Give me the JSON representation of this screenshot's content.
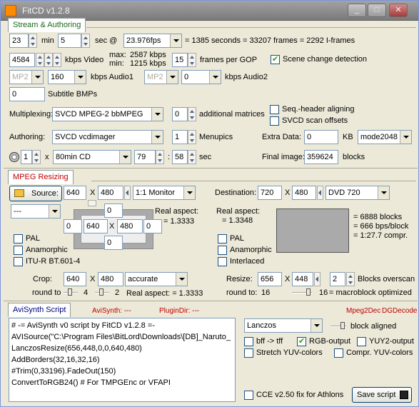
{
  "window": {
    "title": "FitCD v1.2.8",
    "buttons": [
      "_",
      "□",
      "✕"
    ]
  },
  "stream": {
    "tab": "Stream & Authoring",
    "minutes": "23",
    "min_label": "min",
    "seconds": "5",
    "sec_label": "sec @",
    "fps": "23.976fps",
    "summary": "= 1385 seconds = 33207 frames = 2292 I-frames",
    "video_kbps": "4584",
    "kbps_video_label": "kbps Video",
    "max_label": "max:",
    "max_kbps": "2587 kbps",
    "min_label2": "min:",
    "min_kbps": "1215 kbps",
    "gop": "15",
    "gop_label": "frames per GOP",
    "scene_change": "Scene change detection",
    "audio1_codec": "MP2",
    "audio1_kbps": "160",
    "audio1_label": "kbps Audio1",
    "audio2_codec": "MP2",
    "audio2_kbps": "0",
    "audio2_label": "kbps Audio2",
    "subtitle_count": "0",
    "subtitle_label": "Subtitle BMPs",
    "multiplexing_label": "Multiplexing:",
    "multiplexing": "SVCD MPEG-2 bbMPEG",
    "add_matrices": "0",
    "add_matrices_label": "additional matrices",
    "seq_header": "Seq.-header aligning",
    "svcd_scan": "SVCD scan offsets",
    "authoring_label": "Authoring:",
    "authoring": "SVCD vcdimager",
    "menupics": "1",
    "menupics_label": "Menupics",
    "extra_data_label": "Extra Data:",
    "extra_data": "0",
    "kb_label": "KB",
    "mode": "mode2048",
    "cd_count": "1",
    "x_label": "x",
    "cd_type": "80min CD",
    "cd_min": "79",
    "colon": ":",
    "cd_sec": "58",
    "cd_sec_label": "sec",
    "final_image_label": "Final image:",
    "final_image": "359624",
    "blocks_label": "blocks"
  },
  "resize": {
    "tab": "MPEG Resizing",
    "source_label": "Source:",
    "src_w": "640",
    "src_h": "480",
    "monitor": "1:1 Monitor",
    "dest_label": "Destination:",
    "dst_w": "720",
    "dst_h": "480",
    "dest_type": "DVD 720",
    "preset": "---",
    "box_top": "0",
    "box_left": "0",
    "box_w": "640",
    "box_h": "480",
    "box_right": "0",
    "box_bottom": "0",
    "real_aspect_label": "Real aspect:",
    "real_aspect": "= 1.3333",
    "dest_real_aspect": "= 1.3348",
    "stats": [
      "= 6888 blocks",
      "= 666 bps/block",
      "= 1:27.7 compr."
    ],
    "pal": "PAL",
    "anamorphic": "Anamorphic",
    "itu": "ITU-R BT.601-4",
    "pal2": "PAL",
    "anamorphic2": "Anamorphic",
    "interlaced": "Interlaced",
    "crop_label": "Crop:",
    "crop_w": "640",
    "crop_h": "480",
    "accuracy": "accurate",
    "round_to_label": "round to",
    "round_val1": "4",
    "round_val2": "2",
    "crop_real_aspect": "Real aspect: = 1.3333",
    "resize_label": "Resize:",
    "resize_w": "656",
    "resize_h": "448",
    "overscan": "2",
    "overscan_label": "Blocks overscan",
    "round_to2_label": "round to:",
    "round_to2": "16",
    "macro_val": "16",
    "macro_label": "= macroblock optimized"
  },
  "avisynth": {
    "tab": "AviSynth Script",
    "avisynth_label": "AviSynth: ---",
    "plugindir_label": "PluginDir: ---",
    "mpeg2dec": "Mpeg2Dec",
    "dgdecode": "DGDecode",
    "lines": [
      "# -= AviSynth v0 script by FitCD v1.2.8 =-",
      "AVISource(\"C:\\Program Files\\BitLord\\Downloads\\[DB]_Naruto_",
      "LanczosResize(656,448,0,0,640,480)",
      "AddBorders(32,16,32,16)",
      "#Trim(0,33196).FadeOut(150)",
      "ConvertToRGB24() # For TMPGEnc or VFAPI"
    ],
    "resizer": "Lanczos",
    "block_aligned": "block aligned",
    "bff": "bff -> tff",
    "rgb_output": "RGB-output",
    "yuy2": "YUY2-output",
    "stretch": "Stretch YUV-colors",
    "compr": "Compr. YUV-colors",
    "cce_fix": "CCE v2.50 fix for Athlons",
    "save": "Save script"
  },
  "colors": {
    "green_tab": "#1a6b1a",
    "red_tab": "#c00000",
    "accent": "#7f9db9"
  }
}
